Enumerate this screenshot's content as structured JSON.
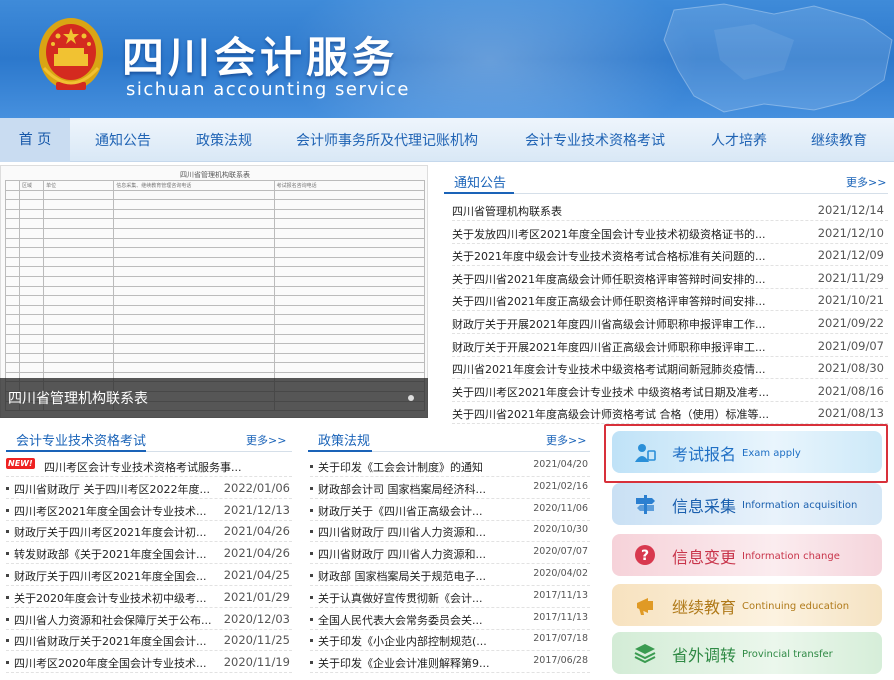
{
  "header": {
    "logo_cn": "四川会计服务",
    "logo_en": "sichuan accounting service"
  },
  "nav": [
    {
      "label": "首 页"
    },
    {
      "label": "通知公告"
    },
    {
      "label": "政策法规"
    },
    {
      "label": "会计师事务所及代理记账机构"
    },
    {
      "label": "会计专业技术资格考试"
    },
    {
      "label": "人才培养"
    },
    {
      "label": "继续教育"
    }
  ],
  "slideshow": {
    "caption": "四川省管理机构联系表",
    "doc_title": "四川省管理机构联系表",
    "doc_header": [
      "",
      "区域",
      "单位",
      "信息采集、继续教育管理咨询电话",
      "考试报名咨询电话"
    ]
  },
  "notices": {
    "title": "通知公告",
    "more": "更多>>",
    "items": [
      {
        "title": "四川省管理机构联系表",
        "date": "2021/12/14"
      },
      {
        "title": "关于发放四川考区2021年度全国会计专业技术初级资格证书的...",
        "date": "2021/12/10"
      },
      {
        "title": "关于2021年度中级会计专业技术资格考试合格标准有关问题的...",
        "date": "2021/12/09"
      },
      {
        "title": "关于四川省2021年度高级会计师任职资格评审答辩时间安排的...",
        "date": "2021/11/29"
      },
      {
        "title": "关于四川省2021年度正高级会计师任职资格评审答辩时间安排...",
        "date": "2021/10/21"
      },
      {
        "title": "财政厅关于开展2021年度四川省高级会计师职称申报评审工作...",
        "date": "2021/09/22"
      },
      {
        "title": "财政厅关于开展2021年度四川省正高级会计师职称申报评审工...",
        "date": "2021/09/07"
      },
      {
        "title": "四川省2021年度会计专业技术中级资格考试期间新冠肺炎疫情...",
        "date": "2021/08/30"
      },
      {
        "title": "关于四川考区2021年度会计专业技术 中级资格考试日期及准考...",
        "date": "2021/08/16"
      },
      {
        "title": "关于四川省2021年度高级会计师资格考试 合格（使用）标准等...",
        "date": "2021/08/13"
      }
    ]
  },
  "exam": {
    "title": "会计专业技术资格考试",
    "more": "更多>>",
    "new_badge": "NEW!",
    "items": [
      {
        "title": "四川考区会计专业技术资格考试服务事...",
        "date": ""
      },
      {
        "title": "四川省财政厅 关于四川考区2022年度...",
        "date": "2022/01/06"
      },
      {
        "title": "四川考区2021年度全国会计专业技术...",
        "date": "2021/12/13"
      },
      {
        "title": "财政厅关于四川考区2021年度会计初...",
        "date": "2021/04/26"
      },
      {
        "title": "转发财政部《关于2021年度全国会计...",
        "date": "2021/04/26"
      },
      {
        "title": "财政厅关于四川考区2021年度全国会...",
        "date": "2021/04/25"
      },
      {
        "title": "关于2020年度会计专业技术初中级考...",
        "date": "2021/01/29"
      },
      {
        "title": "四川省人力资源和社会保障厅关于公布...",
        "date": "2020/12/03"
      },
      {
        "title": "四川省财政厅关于2021年度全国会计...",
        "date": "2020/11/25"
      },
      {
        "title": "四川考区2020年度全国会计专业技术...",
        "date": "2020/11/19"
      }
    ]
  },
  "policy": {
    "title": "政策法规",
    "more": "更多>>",
    "items": [
      {
        "title": "关于印发《工会会计制度》的通知",
        "date": "2021/04/20"
      },
      {
        "title": "财政部会计司 国家档案局经济科...",
        "date": "2021/02/16"
      },
      {
        "title": "财政厅关于《四川省正高级会计...",
        "date": "2020/11/06"
      },
      {
        "title": "四川省财政厅 四川省人力资源和...",
        "date": "2020/10/30"
      },
      {
        "title": "四川省财政厅 四川省人力资源和...",
        "date": "2020/07/07"
      },
      {
        "title": "财政部 国家档案局关于规范电子...",
        "date": "2020/04/02"
      },
      {
        "title": "关于认真做好宣传贯彻新《会计...",
        "date": "2017/11/13"
      },
      {
        "title": "全国人民代表大会常务委员会关...",
        "date": "2017/11/13"
      },
      {
        "title": "关于印发《小企业内部控制规范(...",
        "date": "2017/07/18"
      },
      {
        "title": "关于印发《企业会计准则解释第9...",
        "date": "2017/06/28"
      }
    ]
  },
  "services": [
    {
      "cn": "考试报名",
      "en": "Exam apply",
      "icon": "person-icon"
    },
    {
      "cn": "信息采集",
      "en": "Information acquisition",
      "icon": "signpost-icon"
    },
    {
      "cn": "信息变更",
      "en": "Information change",
      "icon": "question-icon"
    },
    {
      "cn": "继续教育",
      "en": "Continuing education",
      "icon": "megaphone-icon"
    },
    {
      "cn": "省外调转",
      "en": "Provincial transfer",
      "icon": "layers-icon"
    }
  ]
}
